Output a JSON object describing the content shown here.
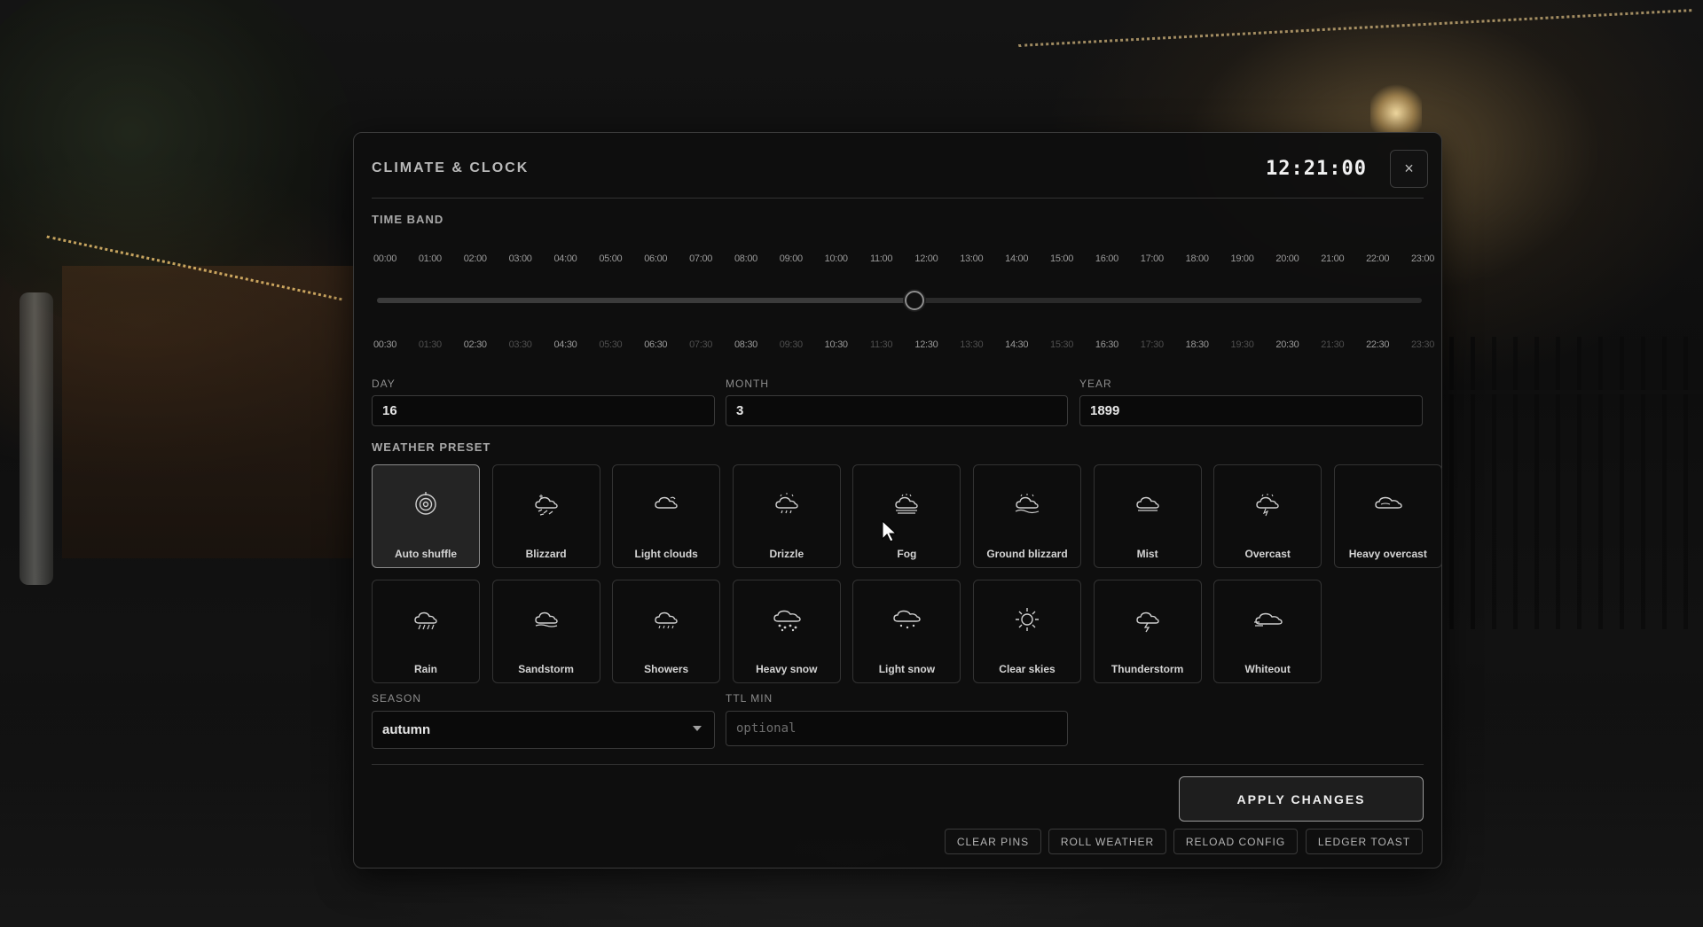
{
  "header": {
    "title": "CLIMATE & CLOCK",
    "clock": "12:21:00",
    "close_glyph": "×"
  },
  "time_band": {
    "label": "TIME BAND",
    "hour_ticks": [
      "00:00",
      "01:00",
      "02:00",
      "03:00",
      "04:00",
      "05:00",
      "06:00",
      "07:00",
      "08:00",
      "09:00",
      "10:00",
      "11:00",
      "12:00",
      "13:00",
      "14:00",
      "15:00",
      "16:00",
      "17:00",
      "18:00",
      "19:00",
      "20:00",
      "21:00",
      "22:00",
      "23:00"
    ],
    "half_ticks": [
      "00:30",
      "01:30",
      "02:30",
      "03:30",
      "04:30",
      "05:30",
      "06:30",
      "07:30",
      "08:30",
      "09:30",
      "10:30",
      "11:30",
      "12:30",
      "13:30",
      "14:30",
      "15:30",
      "16:30",
      "17:30",
      "18:30",
      "19:30",
      "20:30",
      "21:30",
      "22:30",
      "23:30"
    ],
    "value": "12:21"
  },
  "date": {
    "day_label": "DAY",
    "day_value": "16",
    "month_label": "MONTH",
    "month_value": "3",
    "year_label": "YEAR",
    "year_value": "1899"
  },
  "weather": {
    "label": "WEATHER PRESET",
    "selected": "Auto shuffle",
    "presets": [
      {
        "label": "Auto shuffle",
        "icon": "auto-shuffle-icon"
      },
      {
        "label": "Blizzard",
        "icon": "blizzard-icon"
      },
      {
        "label": "Light clouds",
        "icon": "light-clouds-icon"
      },
      {
        "label": "Drizzle",
        "icon": "drizzle-icon"
      },
      {
        "label": "Fog",
        "icon": "fog-icon"
      },
      {
        "label": "Ground blizzard",
        "icon": "ground-blizzard-icon"
      },
      {
        "label": "Mist",
        "icon": "mist-icon"
      },
      {
        "label": "Overcast",
        "icon": "overcast-icon"
      },
      {
        "label": "Heavy overcast",
        "icon": "heavy-overcast-icon"
      },
      {
        "label": "Rain",
        "icon": "rain-icon"
      },
      {
        "label": "Sandstorm",
        "icon": "sandstorm-icon"
      },
      {
        "label": "Showers",
        "icon": "showers-icon"
      },
      {
        "label": "Heavy snow",
        "icon": "heavy-snow-icon"
      },
      {
        "label": "Light snow",
        "icon": "light-snow-icon"
      },
      {
        "label": "Clear skies",
        "icon": "sun-icon"
      },
      {
        "label": "Thunderstorm",
        "icon": "thunderstorm-icon"
      },
      {
        "label": "Whiteout",
        "icon": "whiteout-icon"
      }
    ]
  },
  "season": {
    "label": "SEASON",
    "value": "autumn"
  },
  "ttl": {
    "label": "TTL MIN",
    "placeholder": "optional"
  },
  "actions": {
    "apply": "APPLY CHANGES",
    "clear_pins": "CLEAR PINS",
    "roll_weather": "ROLL WEATHER",
    "reload_config": "RELOAD CONFIG",
    "ledger_toast": "LEDGER TOAST"
  }
}
